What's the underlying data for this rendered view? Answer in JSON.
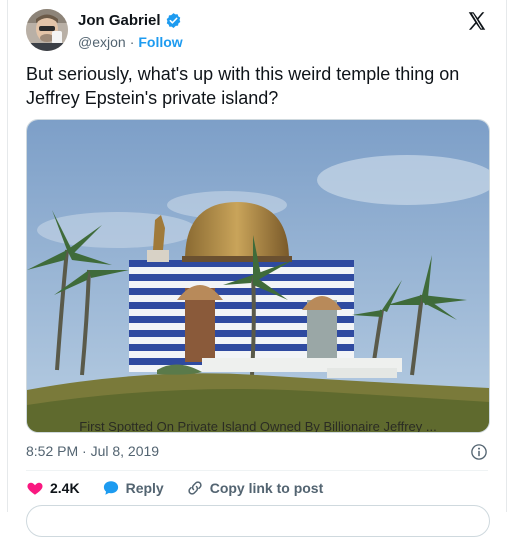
{
  "author": {
    "display_name": "Jon Gabriel",
    "handle": "@exjon",
    "separator": "·",
    "follow_label": "Follow"
  },
  "tweet": {
    "text": "But seriously, what's up with this weird temple thing on Jeffrey Epstein's private island?",
    "media_caption": "First Spotted On Private Island Owned By Billionaire Jeffrey ...",
    "timestamp": "8:52 PM · Jul 8, 2019"
  },
  "actions": {
    "like_count": "2.4K",
    "reply_label": "Reply",
    "copy_link_label": "Copy link to post"
  },
  "colors": {
    "accent": "#1d9bf0",
    "like": "#f91880",
    "text_secondary": "#536471"
  },
  "icons": [
    "verified-badge-icon",
    "x-logo-icon",
    "info-icon",
    "heart-icon",
    "reply-bubble-icon",
    "link-icon"
  ]
}
